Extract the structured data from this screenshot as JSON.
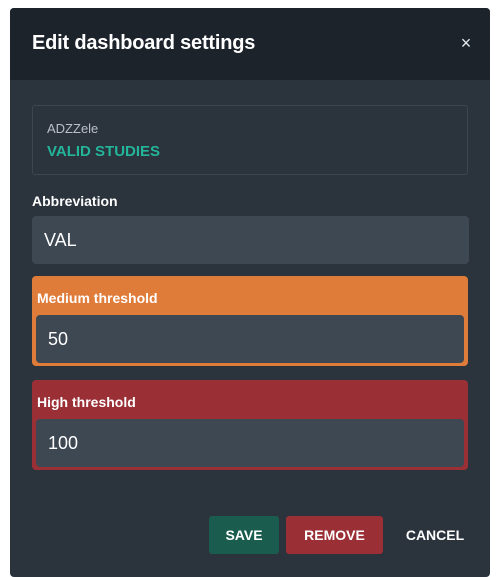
{
  "dialog": {
    "title": "Edit dashboard settings",
    "close_label": "×"
  },
  "info": {
    "subtitle": "ADZZele",
    "name": "VALID STUDIES",
    "name_color": "#23b59a"
  },
  "abbreviation": {
    "label": "Abbreviation",
    "value": "VAL"
  },
  "medium_threshold": {
    "label": "Medium threshold",
    "value": "50",
    "color": "#e07c3a"
  },
  "high_threshold": {
    "label": "High threshold",
    "value": "100",
    "color": "#9a2f35"
  },
  "actions": {
    "save_label": "SAVE",
    "remove_label": "REMOVE",
    "cancel_label": "CANCEL"
  }
}
